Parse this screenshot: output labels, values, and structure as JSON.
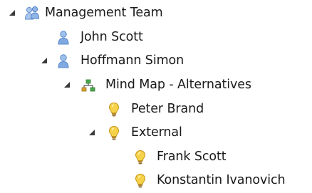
{
  "tree": {
    "root": {
      "label": "Management Team",
      "icon": "team-icon",
      "expanded": true
    },
    "nodes": [
      {
        "label": "John Scott",
        "icon": "person-icon",
        "level": 1,
        "expandable": false
      },
      {
        "label": "Hoffmann Simon",
        "icon": "person-icon",
        "level": 1,
        "expandable": true,
        "expanded": true
      },
      {
        "label": "Mind Map - Alternatives",
        "icon": "mind-map-icon",
        "level": 2,
        "expandable": true,
        "expanded": true
      },
      {
        "label": "Peter Brand",
        "icon": "lightbulb-icon",
        "level": 3,
        "expandable": false
      },
      {
        "label": "External",
        "icon": "lightbulb-icon",
        "level": 3,
        "expandable": true,
        "expanded": true
      },
      {
        "label": "Frank Scott",
        "icon": "lightbulb-icon",
        "level": 4,
        "expandable": false
      },
      {
        "label": "Konstantin Ivanovich",
        "icon": "lightbulb-icon",
        "level": 4,
        "expandable": false
      }
    ]
  },
  "colors": {
    "person_blue": "#6f9fd8",
    "bulb_yellow": "#f2c230",
    "mindmap_green": "#3f9a3f",
    "toggle": "#3a3a3a"
  }
}
